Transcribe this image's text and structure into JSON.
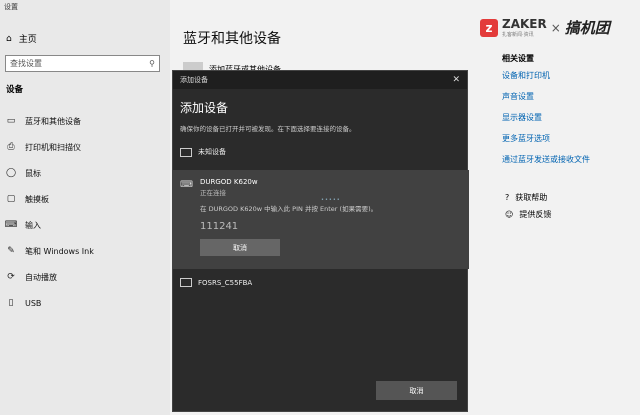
{
  "window": {
    "title": "设置"
  },
  "sidebar": {
    "home": "主页",
    "search_placeholder": "查找设置",
    "section": "设备",
    "items": [
      {
        "label": "蓝牙和其他设备",
        "icon": "bluetooth-devices-icon"
      },
      {
        "label": "打印机和扫描仪",
        "icon": "printer-icon"
      },
      {
        "label": "鼠标",
        "icon": "mouse-icon"
      },
      {
        "label": "触摸板",
        "icon": "touchpad-icon"
      },
      {
        "label": "输入",
        "icon": "keyboard-icon"
      },
      {
        "label": "笔和 Windows Ink",
        "icon": "pen-icon"
      },
      {
        "label": "自动播放",
        "icon": "autoplay-icon"
      },
      {
        "label": "USB",
        "icon": "usb-icon"
      }
    ]
  },
  "main": {
    "title": "蓝牙和其他设备",
    "add_device": "添加蓝牙或其他设备"
  },
  "related": {
    "heading": "相关设置",
    "links": [
      "设备和打印机",
      "声音设置",
      "显示器设置",
      "更多蓝牙选项",
      "通过蓝牙发送或接收文件"
    ]
  },
  "help": {
    "get_help": "获取帮助",
    "feedback": "提供反馈"
  },
  "logo": {
    "brand": "ZAKER",
    "sub": "扎客新闻·资讯",
    "partner": "搞机团"
  },
  "dialog": {
    "titlebar": "添加设备",
    "heading": "添加设备",
    "description": "确保你的设备已打开并可被发现。在下面选择要连接的设备。",
    "device_unknown": "未知设备",
    "selected": {
      "name": "DURGOD K620w",
      "status": "正在连接",
      "instruction": "在 DURGOD K620w 中输入此 PIN 并按 Enter (如果需要)。",
      "pin": "111241",
      "cancel": "取消"
    },
    "device_other": "FOSRS_C55FBA",
    "cancel": "取消"
  },
  "colors": {
    "accent": "#0063b1",
    "dialog_bg": "#2b2b2b",
    "selected_bg": "#414141"
  }
}
